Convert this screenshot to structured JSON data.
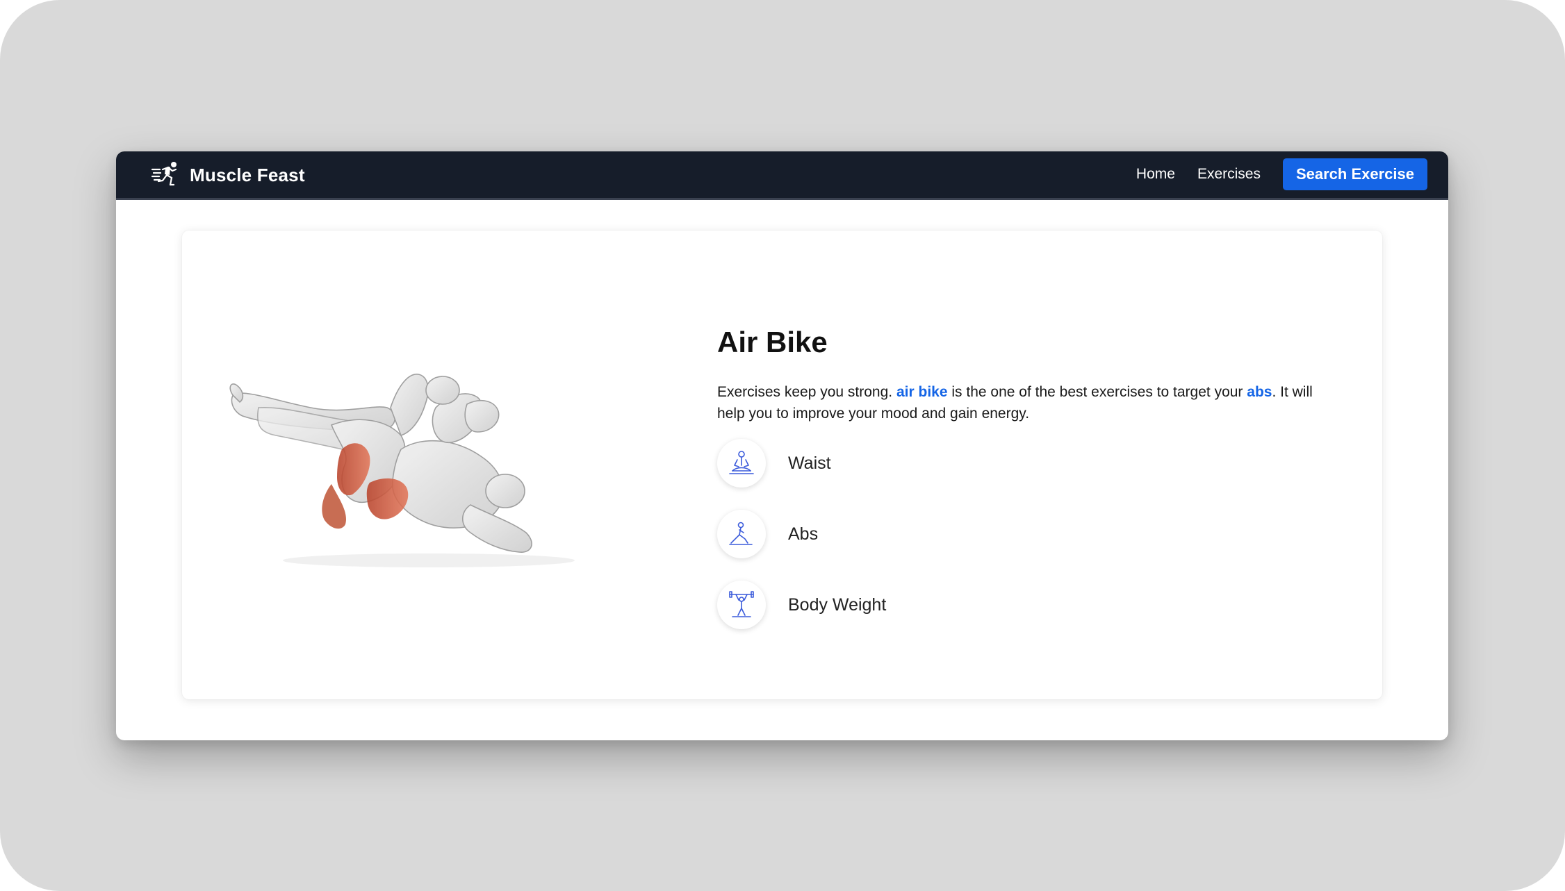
{
  "brand": {
    "name": "Muscle Feast",
    "logo_icon": "running-man-icon"
  },
  "nav": {
    "links": [
      {
        "label": "Home"
      },
      {
        "label": "Exercises"
      }
    ],
    "cta_label": "Search Exercise"
  },
  "exercise": {
    "name": "Air Bike",
    "description_prefix": "Exercises keep you strong.",
    "exercise_link": "air bike",
    "description_middle": "is the one of the best exercises to target your",
    "target_link": "abs",
    "description_suffix": ". It will help you to improve your mood and gain energy.",
    "image_icon": "air-bike-exercise-illustration",
    "tags": [
      {
        "label": "Waist",
        "icon": "meditation-icon"
      },
      {
        "label": "Abs",
        "icon": "lunge-stretch-icon"
      },
      {
        "label": "Body Weight",
        "icon": "weightlifter-icon"
      }
    ]
  },
  "colors": {
    "accent": "#1565e6",
    "navbar": "#161d2a",
    "backdrop": "#d9d9d9",
    "muscle_highlight": "#c94a2e"
  }
}
